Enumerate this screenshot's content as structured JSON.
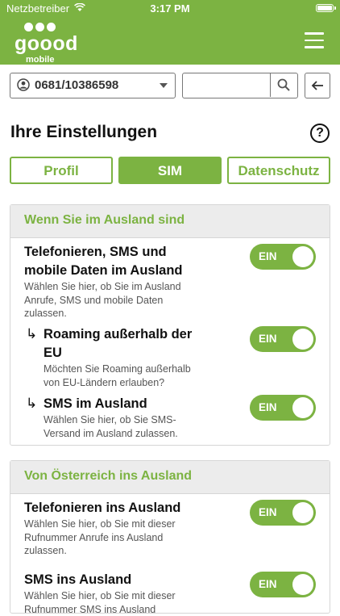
{
  "status_bar": {
    "carrier": "Netzbetreiber",
    "time": "3:17 PM"
  },
  "app": {
    "logo_word": "goood",
    "logo_sub": "mobile"
  },
  "selector": {
    "number": "0681/10386598"
  },
  "search": {
    "placeholder": ""
  },
  "page": {
    "title": "Ihre Einstellungen",
    "help": "?"
  },
  "tabs": [
    {
      "label": "Profil",
      "active": false
    },
    {
      "label": "SIM",
      "active": true
    },
    {
      "label": "Datenschutz",
      "active": false
    }
  ],
  "sections": [
    {
      "title": "Wenn Sie im Ausland sind",
      "items": [
        {
          "title_lines": [
            "Telefonieren, SMS und",
            "mobile Daten im Ausland"
          ],
          "desc_lines": [
            "Wählen Sie hier, ob Sie im Ausland",
            "Anrufe, SMS und mobile Daten",
            "zulassen."
          ],
          "toggle": "EIN"
        },
        {
          "sub": true,
          "arrow": "↳",
          "title_lines": [
            "Roaming außerhalb der",
            "EU"
          ],
          "desc_lines": [
            "Möchten Sie Roaming außerhalb",
            "von EU-Ländern erlauben?"
          ],
          "toggle": "EIN"
        },
        {
          "sub": true,
          "arrow": "↳",
          "title_lines": [
            "SMS im Ausland"
          ],
          "desc_lines": [
            "Wählen Sie hier, ob Sie SMS-",
            "Versand im Ausland zulassen."
          ],
          "toggle": "EIN"
        }
      ]
    },
    {
      "title": "Von Österreich ins Ausland",
      "items": [
        {
          "title_lines": [
            "Telefonieren ins Ausland"
          ],
          "desc_lines": [
            "Wählen Sie hier, ob Sie mit dieser",
            "Rufnummer Anrufe ins Ausland",
            "zulassen."
          ],
          "toggle": "EIN"
        },
        {
          "title_lines": [
            "SMS ins Ausland"
          ],
          "desc_lines": [
            "Wählen Sie hier, ob Sie mit dieser",
            "Rufnummer SMS ins Ausland"
          ],
          "toggle": "EIN"
        }
      ]
    }
  ],
  "colors": {
    "brand": "#7cb342",
    "section_head_bg": "#ececec"
  }
}
